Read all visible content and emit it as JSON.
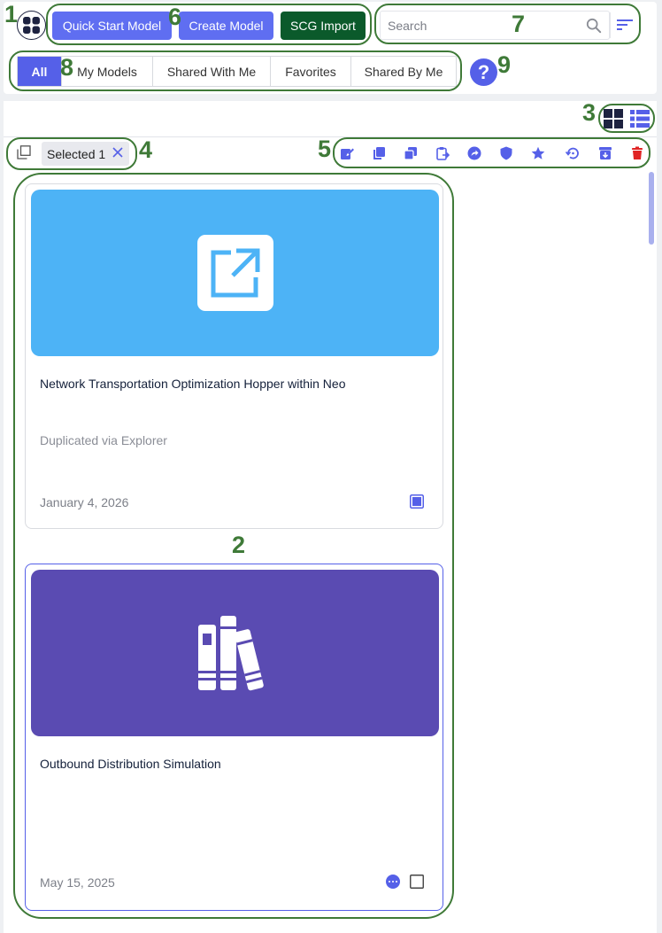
{
  "header": {
    "app_icon": "grid-apps-icon",
    "buttons": {
      "quick_start": "Quick Start Model",
      "create": "Create Model",
      "scg_import": "SCG Import"
    },
    "search": {
      "placeholder": "Search",
      "icon": "search-icon"
    },
    "filter_icon": "filter-lines-icon"
  },
  "tabs": [
    {
      "label": "All",
      "active": true
    },
    {
      "label": "My Models",
      "active": false
    },
    {
      "label": "Shared With Me",
      "active": false
    },
    {
      "label": "Favorites",
      "active": false
    },
    {
      "label": "Shared By Me",
      "active": false
    }
  ],
  "help": {
    "label": "?"
  },
  "view_toggle": {
    "grid_icon": "grid-view-icon",
    "list_icon": "list-view-icon"
  },
  "selection": {
    "chip_label": "Selected 1",
    "select_all_icon": "select-all-icon",
    "clear_icon": "close-icon"
  },
  "toolbar_icons": [
    "edit-icon",
    "copy-icon",
    "duplicate-icon",
    "paste-icon",
    "share-icon",
    "shield-icon",
    "star-icon",
    "restore-icon",
    "archive-icon",
    "delete-icon"
  ],
  "cards": [
    {
      "title": "Network Transportation Optimization Hopper within Neo",
      "description": "Duplicated via Explorer",
      "date": "January 4, 2026",
      "banner_color": "#4db3f6",
      "banner_icon": "open-external-icon",
      "checked": true
    },
    {
      "title": "Outbound Distribution Simulation",
      "description": "",
      "date": "May 15, 2025",
      "banner_color": "#5a4bb2",
      "banner_icon": "books-icon",
      "checked": false
    }
  ],
  "annotations": [
    "1",
    "2",
    "3",
    "4",
    "5",
    "6",
    "7",
    "8",
    "9"
  ],
  "colors": {
    "accent": "#5560e8",
    "primary_button": "#5f6ef1",
    "import_button": "#0b5a2b",
    "annotation": "#3f7a38",
    "delete": "#e02424"
  }
}
